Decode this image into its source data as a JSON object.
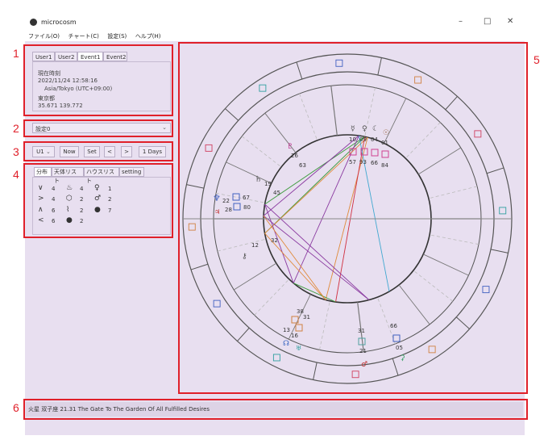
{
  "window": {
    "title": "microcosm"
  },
  "menu": [
    "ファイル(O)",
    "チャート(C)",
    "設定(S)",
    "ヘルプ(H)"
  ],
  "user_tabs": [
    "User1",
    "User2",
    "Event1",
    "Event2"
  ],
  "event_info": {
    "line1": "現在時刻",
    "line2": "2022/11/24 12:58:16",
    "line3": "Asia/Tokyo (UTC+09:00)",
    "line4": "東京都",
    "line5": "35.671 139.772"
  },
  "settings_select": {
    "value": "設定0"
  },
  "nav": {
    "user": "U1",
    "now": "Now",
    "set": "Set",
    "prev": "<",
    "next": ">",
    "step": "1 Days"
  },
  "lower_tabs": [
    "分布",
    "天体リスト",
    "ハウスリスト",
    "setting"
  ],
  "distribution": {
    "c1": [
      "4",
      "4",
      "6",
      "6"
    ],
    "c2": [
      "4",
      "2",
      "2",
      "2"
    ],
    "c3": [
      "1",
      "2",
      "7"
    ]
  },
  "status_bar": {
    "text": "火星 双子座 21.31 The Gate To The Garden Of All Fulfilled Desires"
  },
  "annotations": [
    "1",
    "2",
    "3",
    "4",
    "5",
    "6"
  ],
  "chart_labels": {
    "p26": "26",
    "p63": "63",
    "p19": "19",
    "p45": "45",
    "p10": "10",
    "p09": "09",
    "p04": "04",
    "p01": "01",
    "p57": "57",
    "p93": "93",
    "p66": "66",
    "p84": "84",
    "p22": "22",
    "p67": "67",
    "p28": "28",
    "p80": "80",
    "p12": "12",
    "p32": "32",
    "p38": "38",
    "p31": "31",
    "p13": "13",
    "p16": "16",
    "p31b": "31",
    "p21": "21",
    "p66b": "66",
    "p05": "05"
  },
  "colors": {
    "accent_red": "#e0202a",
    "panel_bg": "#e8dff0",
    "ring": "#555555"
  }
}
